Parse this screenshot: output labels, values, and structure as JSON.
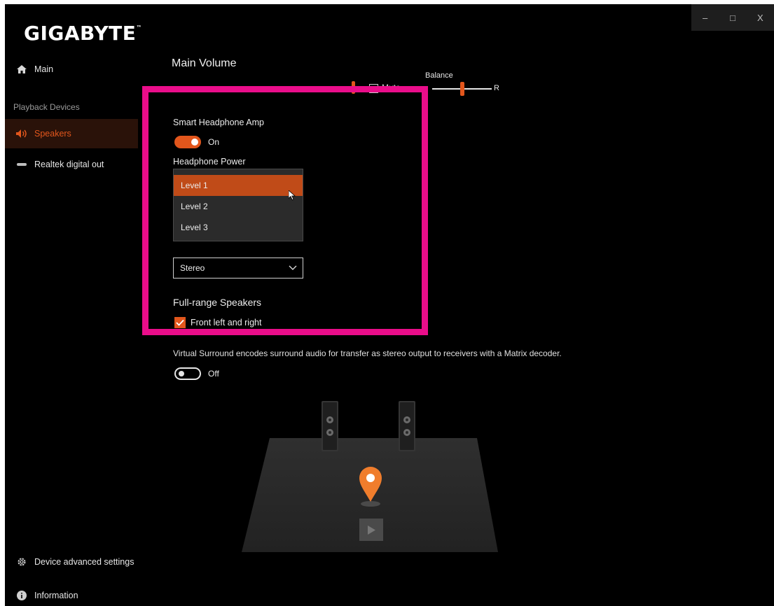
{
  "window": {
    "brand": "GIGABYTE",
    "brand_tm": "™",
    "minimize": "–",
    "maximize": "□",
    "close": "X"
  },
  "sidebar": {
    "main": "Main",
    "section": "Playback Devices",
    "items": [
      {
        "label": "Speakers",
        "active": true
      },
      {
        "label": "Realtek digital out",
        "active": false
      }
    ],
    "advanced": "Device advanced settings",
    "information": "Information"
  },
  "main": {
    "title": "Main Volume",
    "mute_label": "Mute",
    "balance_label": "Balance",
    "balance_right": "R",
    "smart_amp_label": "Smart Headphone Amp",
    "smart_amp_state": "On",
    "headphone_power_label": "Headphone Power",
    "power_options": [
      "Level 1",
      "Level 2",
      "Level 3"
    ],
    "power_selected": "Level 1",
    "config_value": "Stereo",
    "fullrange_label": "Full-range Speakers",
    "front_lr_label": "Front left and right",
    "front_lr_checked": true,
    "virtual_surround_desc": "Virtual Surround encodes surround audio for transfer as stereo output to receivers with a Matrix decoder.",
    "virtual_surround_state": "Off"
  },
  "colors": {
    "accent": "#e2561c",
    "highlight": "#ea0d8a",
    "background": "#000000"
  }
}
